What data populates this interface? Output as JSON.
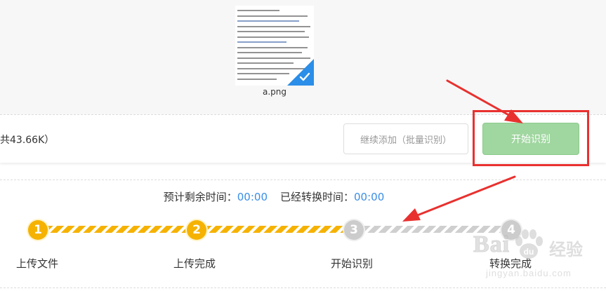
{
  "file": {
    "name": "a.png",
    "selected": true
  },
  "action_bar": {
    "size_text": "共43.66K）",
    "continue_label": "继续添加（批量识别）",
    "start_label": "开始识别"
  },
  "progress": {
    "remaining_label": "预计剩余时间：",
    "remaining_value": "00:00",
    "elapsed_label": "已经转换时间：",
    "elapsed_value": "00:00",
    "completed_steps": 2,
    "steps": [
      {
        "number": "1",
        "label": "上传文件",
        "state": "done"
      },
      {
        "number": "2",
        "label": "上传完成",
        "state": "done"
      },
      {
        "number": "3",
        "label": "开始识别",
        "state": "todo"
      },
      {
        "number": "4",
        "label": "转换完成",
        "state": "todo"
      }
    ]
  },
  "watermark": {
    "brand": "Bai",
    "brand_tail": "经验",
    "url": "jingyan.baidu.com"
  },
  "colors": {
    "accent_blue": "#3a8ee6",
    "step_done": "#f5b200",
    "step_todo": "#cccccc",
    "start_button": "#a0d6a0",
    "annotation_red": "#e8312f",
    "check_blue": "#2b8ee8"
  },
  "icons": {
    "check": "check-icon",
    "arrow": "red-arrow-icon",
    "paw": "baidu-paw-icon"
  }
}
